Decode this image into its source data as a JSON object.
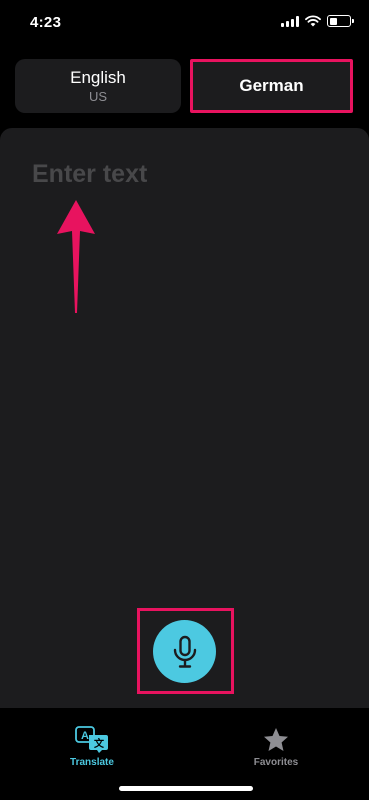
{
  "status_bar": {
    "time": "4:23",
    "icons": [
      "signal-icon",
      "wifi-icon",
      "battery-icon"
    ],
    "battery_level": 0.4
  },
  "language_selector": {
    "source": {
      "name": "English",
      "region": "US"
    },
    "target": {
      "name": "German"
    }
  },
  "input": {
    "placeholder": "Enter text",
    "value": ""
  },
  "mic_button": {
    "icon": "microphone-icon"
  },
  "tab_bar": {
    "tabs": [
      {
        "label": "Translate",
        "icon": "translate-icon",
        "active": true
      },
      {
        "label": "Favorites",
        "icon": "star-icon",
        "active": false
      }
    ]
  },
  "colors": {
    "accent": "#4cc9e1",
    "annotation": "#e8135f",
    "panel": "#1c1c1e",
    "background": "#000000",
    "inactive": "#8e8e93"
  }
}
